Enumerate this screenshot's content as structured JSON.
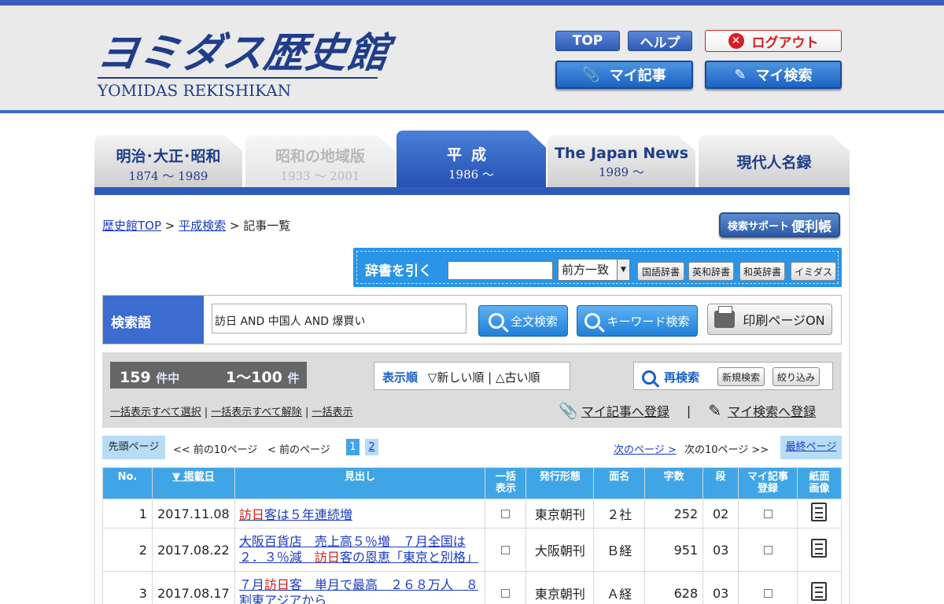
{
  "header": {
    "logo_jp": "ヨミダス歴史館",
    "logo_en": "YOMIDAS REKISHIKAN",
    "top_label": "TOP",
    "help_label": "ヘルプ",
    "logout_label": "ログアウト",
    "my_article_label": "マイ記事",
    "my_search_label": "マイ検索"
  },
  "tabs": [
    {
      "label": "明治･大正･昭和",
      "sub": "1874 〜 1989"
    },
    {
      "label": "昭和の地域版",
      "sub": "1933 〜 2001"
    },
    {
      "label": "平成",
      "sub": "1986 〜"
    },
    {
      "label": "The Japan News",
      "sub": "1989 〜"
    },
    {
      "label": "現代人名録",
      "sub": ""
    }
  ],
  "breadcrumb": {
    "top": "歴史館TOP",
    "sep1": " > ",
    "search": "平成検索",
    "sep2": " > ",
    "current": "記事一覧"
  },
  "support": {
    "small": "検索サポート",
    "big": "便利帳"
  },
  "dictionary": {
    "label": "辞書を引く",
    "input_value": "",
    "match_option": "前方一致",
    "buttons": [
      "国語辞書",
      "英和辞書",
      "和英辞書",
      "イミダス"
    ]
  },
  "search": {
    "label": "検索語",
    "query": "訪日 AND 中国人 AND 爆買い",
    "fulltext_label": "全文検索",
    "keyword_label": "キーワード検索",
    "print_label": "印刷ページON"
  },
  "results": {
    "total": "159",
    "total_unit": "件中",
    "range": "1〜100",
    "range_unit": "件",
    "sort_label": "表示順",
    "sort_new": "▽新しい順",
    "sort_sep": " | ",
    "sort_old": "△古い順",
    "research_label": "再検索",
    "new_search": "新規検索",
    "narrow": "絞り込み",
    "bulk_select_all": "一括表示すべて選択",
    "bulk_deselect_all": "一括表示すべて解除",
    "bulk_show": "一括表示",
    "bulk_sep": " | ",
    "register_article": "マイ記事へ登録",
    "register_sep": "|",
    "register_search": "マイ検索へ登録"
  },
  "pager": {
    "first": "先頭ページ",
    "prev10": "<< 前の10ページ",
    "prev": "< 前のページ",
    "pages": [
      "1",
      "2"
    ],
    "next": "次のページ >",
    "next10": "次の10ページ >>",
    "last": "最終ページ"
  },
  "table": {
    "headers": {
      "no": "No.",
      "date": "▼ 掲載日",
      "headline": "見出し",
      "bulk": "一括\n表示",
      "edition": "発行形態",
      "page": "面名",
      "chars": "字数",
      "column": "段",
      "my_article": "マイ記事\n登録",
      "image": "紙面\n画像"
    },
    "rows": [
      {
        "no": "1",
        "date": "2017.11.08",
        "hl_pre": "",
        "hl_mark": "訪日",
        "hl_post": "客は５年連続増",
        "hl_line2_pre": "",
        "hl_line2_mark": "",
        "hl_line2_post": "",
        "edition": "東京朝刊",
        "page": "２社",
        "chars": "252",
        "column": "02"
      },
      {
        "no": "2",
        "date": "2017.08.22",
        "hl_pre": "大阪百貨店　売上高５％増　７月全国は",
        "hl_mark": "",
        "hl_post": "",
        "hl_line2_pre": "２．３％減　",
        "hl_line2_mark": "訪日",
        "hl_line2_post": "客の恩恵「東京と別格」",
        "edition": "大阪朝刊",
        "page": "Ｂ経",
        "chars": "951",
        "column": "03"
      },
      {
        "no": "3",
        "date": "2017.08.17",
        "hl_pre": "７月",
        "hl_mark": "訪日",
        "hl_post": "客　単月で最高　２６８万人　８",
        "hl_line2_pre": "割東アジアから",
        "hl_line2_mark": "",
        "hl_line2_post": "",
        "edition": "東京朝刊",
        "page": "Ａ経",
        "chars": "628",
        "column": "03"
      }
    ]
  },
  "colors": {
    "brand_blue": "#3c6ccf",
    "table_header": "#3fa5e6",
    "highlight_red": "#d01818",
    "logout_red": "#d42020"
  }
}
